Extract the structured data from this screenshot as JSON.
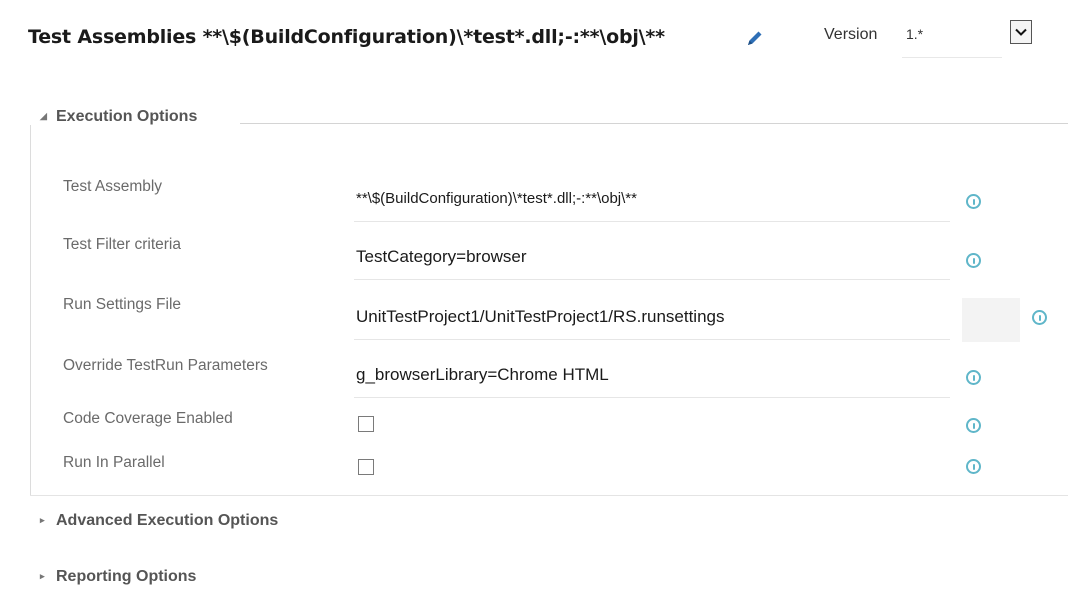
{
  "header": {
    "title": "Test Assemblies **\\$(BuildConfiguration)\\*test*.dll;-:**\\obj\\**",
    "version_label": "Version",
    "version_value": "1.*"
  },
  "sections": {
    "execution": {
      "label": "Execution Options",
      "expanded": true
    },
    "advanced": {
      "label": "Advanced Execution Options",
      "expanded": false
    },
    "reporting": {
      "label": "Reporting Options",
      "expanded": false
    }
  },
  "fields": [
    {
      "label": "Test Assembly",
      "value": "**\\$(BuildConfiguration)\\*test*.dll;-:**\\obj\\**"
    },
    {
      "label": "Test Filter criteria",
      "value": "TestCategory=browser"
    },
    {
      "label": "Run Settings File",
      "value": "UnitTestProject1/UnitTestProject1/RS.runsettings"
    },
    {
      "label": "Override TestRun Parameters",
      "value": "g_browserLibrary=Chrome HTML"
    },
    {
      "label": "Code Coverage Enabled",
      "checked": false
    },
    {
      "label": "Run In Parallel",
      "checked": false
    }
  ],
  "icons": {
    "info": "info-icon",
    "edit": "pencil-icon",
    "dropdown": "chevron-down-icon"
  },
  "colors": {
    "info_accent": "#5fb6c9",
    "pencil_accent": "#2e6fb6"
  }
}
